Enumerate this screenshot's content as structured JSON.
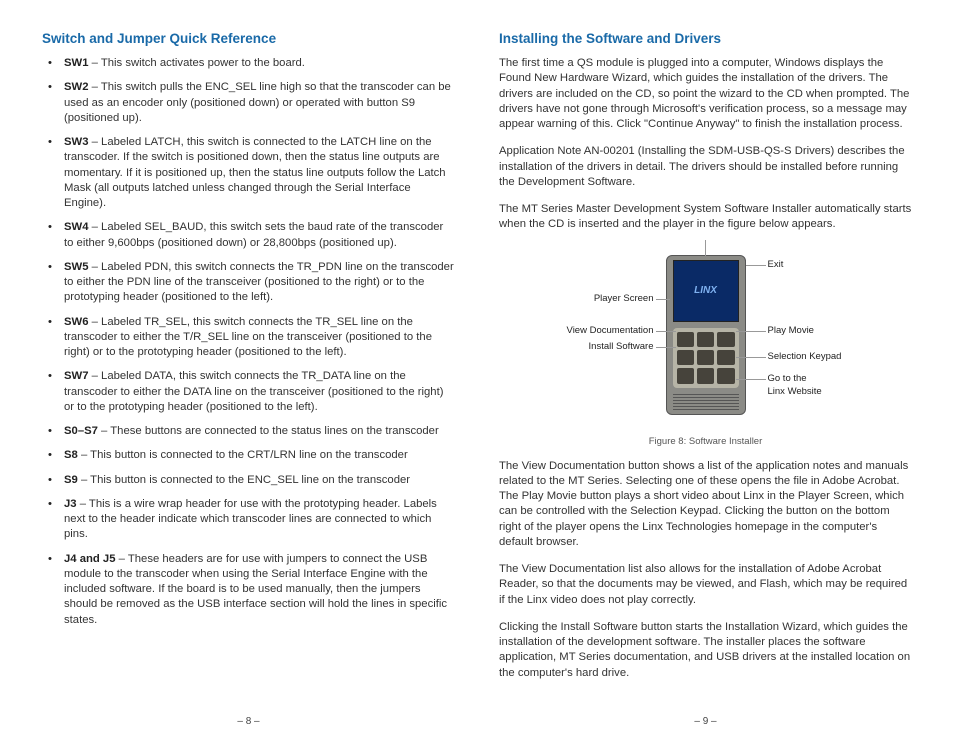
{
  "left": {
    "heading": "Switch and Jumper Quick Reference",
    "items": [
      {
        "label": "SW1",
        "text": " – This switch activates power to the board."
      },
      {
        "label": "SW2",
        "text": " – This switch pulls the ENC_SEL line high so that the transcoder can be used as an encoder only (positioned down) or operated with button S9 (positioned up)."
      },
      {
        "label": "SW3",
        "text": " – Labeled LATCH, this switch is connected to the LATCH line on the transcoder. If the switch is positioned down, then the status line outputs are momentary. If it is positioned up, then the status line outputs follow the Latch Mask (all outputs latched unless changed through the Serial Interface Engine)."
      },
      {
        "label": "SW4",
        "text": " – Labeled SEL_BAUD, this switch sets the baud rate of the transcoder to either 9,600bps (positioned down) or 28,800bps (positioned up)."
      },
      {
        "label": "SW5",
        "text": " – Labeled PDN, this switch connects the TR_PDN line on the transcoder to either the PDN line of the transceiver (positioned to the right) or to the prototyping header (positioned to the left)."
      },
      {
        "label": "SW6",
        "text": " – Labeled TR_SEL, this switch connects the TR_SEL line on the transcoder to either the T/R_SEL line on the transceiver (positioned to the right) or to the prototyping header (positioned to the left)."
      },
      {
        "label": "SW7",
        "text": " – Labeled DATA, this switch connects the TR_DATA line on the transcoder to either the DATA line on the transceiver (positioned to the right) or to the prototyping header (positioned to the left)."
      },
      {
        "label": "S0–S7",
        "text": " – These buttons are connected to the status lines on the transcoder"
      },
      {
        "label": "S8",
        "text": " – This button is connected to the CRT/LRN line on the transcoder"
      },
      {
        "label": "S9",
        "text": " – This button is connected to the ENC_SEL line on the transcoder"
      },
      {
        "label": "J3",
        "text": " – This is a wire wrap header for use with the prototyping header. Labels next to the header indicate which transcoder lines are connected to which pins."
      },
      {
        "label": "J4 and J5",
        "text": " – These headers are for use with jumpers to connect the USB module to the transcoder when using the Serial Interface Engine with the included software. If the board is to be used manually, then the jumpers should be removed as the USB interface section will hold the lines in specific states."
      }
    ],
    "page": "– 8 –"
  },
  "right": {
    "heading": "Installing the Software and Drivers",
    "p1": "The first time a QS module is plugged into a computer, Windows displays the Found New Hardware Wizard, which guides the installation of the drivers. The drivers are included on the CD, so point the wizard to the CD when prompted. The drivers have not gone through Microsoft's verification process, so a message may appear warning of this. Click \"Continue Anyway\" to finish the installation process.",
    "p2": "Application Note AN-00201 (Installing the SDM-USB-QS-S Drivers) describes the installation of the drivers in detail. The drivers should be installed before running the Development Software.",
    "p3": "The MT Series Master Development System Software Installer automatically starts when the CD is inserted and the player in the figure below appears.",
    "fig": {
      "brand": "LINX",
      "callouts": {
        "player_screen": "Player Screen",
        "view_doc": "View Documentation",
        "install": "Install Software",
        "exit": "Exit",
        "play": "Play Movie",
        "keypad": "Selection Keypad",
        "website": "Go to the\nLinx Website"
      },
      "caption": "Figure 8: Software Installer"
    },
    "p4": "The View Documentation button shows a list of the application notes and manuals related to the MT Series. Selecting one of these opens the file in Adobe Acrobat. The Play Movie button plays a short video about Linx in the Player Screen, which can be controlled with the Selection Keypad. Clicking the button on the bottom right of the player opens the Linx Technologies homepage in the computer's default browser.",
    "p5": "The View Documentation list also allows for the installation of Adobe Acrobat Reader, so that the documents may be viewed, and Flash, which may be required if the Linx video does not play correctly.",
    "p6": "Clicking the Install Software button starts the Installation Wizard, which guides the installation of the development software. The installer places the software application, MT Series documentation, and USB drivers at the installed location on the computer's hard drive.",
    "page": "– 9 –"
  }
}
